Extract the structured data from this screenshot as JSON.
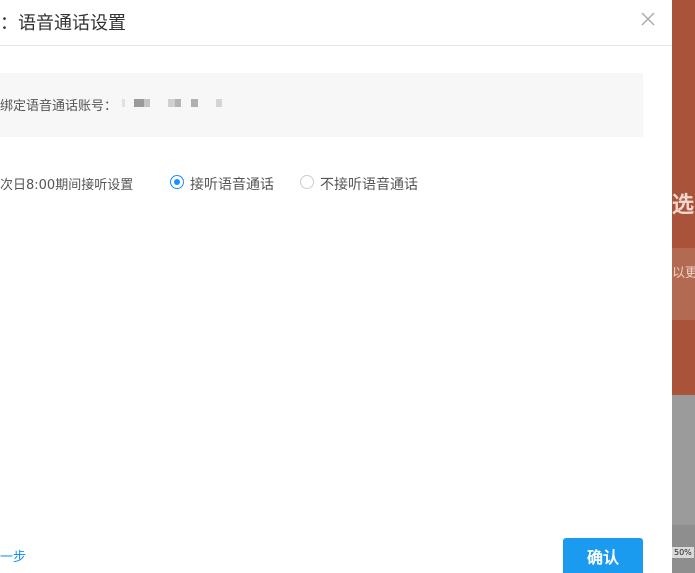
{
  "modal": {
    "title": "：语音通话设置",
    "close_icon": "close-icon"
  },
  "account": {
    "label": "绑定语音通话账号：",
    "value_masked": true
  },
  "setting": {
    "label": "次日8:00期间接听设置",
    "options": [
      {
        "label": "接听语音通话",
        "checked": true
      },
      {
        "label": "不接听语音通话",
        "checked": false
      }
    ]
  },
  "footer": {
    "prev_label": "一步",
    "confirm_label": "确认"
  },
  "background": {
    "char": "选",
    "text": "以更",
    "zoom": "50%"
  },
  "colors": {
    "accent": "#1890ff",
    "confirm_bg": "#1a9bf0",
    "background_panel": "#a9543a"
  }
}
